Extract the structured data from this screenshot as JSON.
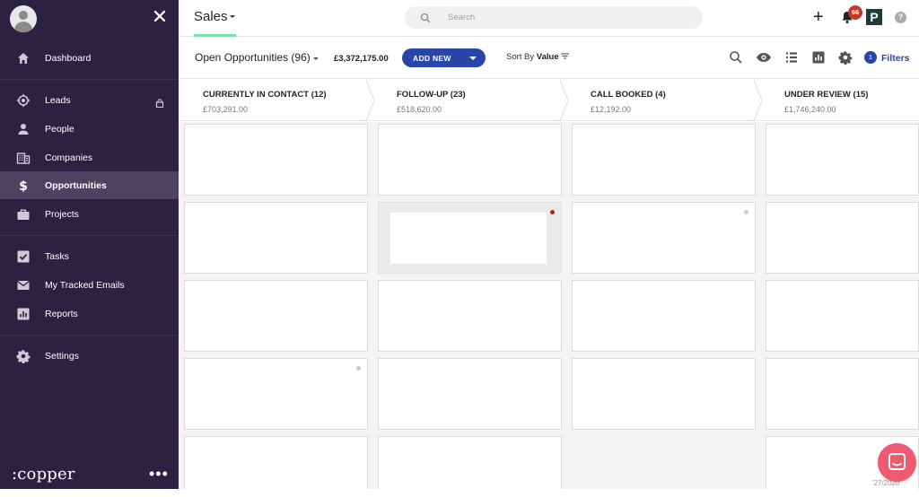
{
  "sidebar": {
    "close_label": "✕",
    "items": [
      {
        "label": "Dashboard",
        "icon": "home-icon"
      },
      {
        "label": "Leads",
        "icon": "target-icon"
      },
      {
        "label": "People",
        "icon": "person-icon"
      },
      {
        "label": "Companies",
        "icon": "building-icon"
      },
      {
        "label": "Opportunities",
        "icon": "dollar-icon",
        "active": true
      },
      {
        "label": "Projects",
        "icon": "briefcase-icon"
      },
      {
        "label": "Tasks",
        "icon": "checkbox-icon"
      },
      {
        "label": "My Tracked Emails",
        "icon": "mail-icon"
      },
      {
        "label": "Reports",
        "icon": "bar-chart-icon"
      },
      {
        "label": "Settings",
        "icon": "gear-icon"
      }
    ],
    "brand": ":copper",
    "more_label": "•••"
  },
  "header": {
    "title": "Sales",
    "search_placeholder": "Search",
    "plus_label": "+",
    "notification_count": "66",
    "app_logo_letter": "P",
    "help_label": "?"
  },
  "toolbar": {
    "pipeline_name": "Open Opportunities (96)",
    "total_value": "£3,372,175.00",
    "add_new_label": "ADD NEW",
    "sort_prefix": "Sort By",
    "sort_value": "Value",
    "filters_count": "1",
    "filters_label": "Filters"
  },
  "stages": [
    {
      "name": "CURRENTLY IN CONTACT (12)",
      "value": "£703,291.00"
    },
    {
      "name": "FOLLOW-UP (23)",
      "value": "£518,620.00"
    },
    {
      "name": "CALL BOOKED (4)",
      "value": "£12,192.00"
    },
    {
      "name": "UNDER REVIEW (15)",
      "value": "£1,746,240.00"
    }
  ],
  "footer": {
    "date_stamp": "'27/2020"
  },
  "colors": {
    "sidebar_bg": "#2c2140",
    "sidebar_active": "#4d4360",
    "accent_blue": "#2945a7",
    "tab_underline": "#7ee0a6",
    "badge_red": "#c0392b",
    "chat_fab": "#ee5a6f"
  }
}
